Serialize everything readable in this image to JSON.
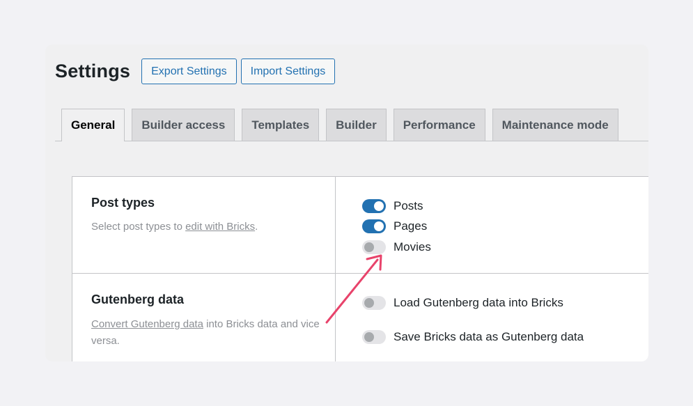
{
  "header": {
    "title": "Settings",
    "export_label": "Export Settings",
    "import_label": "Import Settings"
  },
  "tabs": [
    {
      "label": "General",
      "active": true
    },
    {
      "label": "Builder access",
      "active": false
    },
    {
      "label": "Templates",
      "active": false
    },
    {
      "label": "Builder",
      "active": false
    },
    {
      "label": "Performance",
      "active": false
    },
    {
      "label": "Maintenance mode",
      "active": false
    }
  ],
  "post_types": {
    "title": "Post types",
    "desc_prefix": "Select post types to ",
    "desc_link": "edit with Bricks",
    "desc_suffix": ".",
    "options": [
      {
        "label": "Posts",
        "on": true
      },
      {
        "label": "Pages",
        "on": true
      },
      {
        "label": "Movies",
        "on": false
      }
    ]
  },
  "gutenberg": {
    "title": "Gutenberg data",
    "desc_link": "Convert Gutenberg data",
    "desc_suffix": " into Bricks data and vice versa.",
    "options": [
      {
        "label": "Load Gutenberg data into Bricks",
        "on": false
      },
      {
        "label": "Save Bricks data as Gutenberg data",
        "on": false
      }
    ]
  },
  "colors": {
    "accent": "#2271b1",
    "annotation_arrow": "#e8436b"
  }
}
